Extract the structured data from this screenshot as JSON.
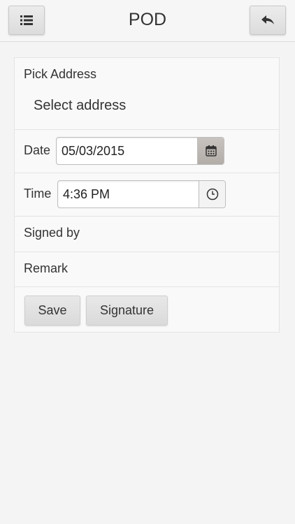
{
  "header": {
    "title": "POD",
    "menu_icon": "list-icon",
    "back_icon": "reply-arrow-icon"
  },
  "form": {
    "pick_address_label": "Pick Address",
    "pick_address_value": "Select address",
    "date_label": "Date",
    "date_value": "05/03/2015",
    "date_icon": "calendar-icon",
    "time_label": "Time",
    "time_value": "4:36 PM",
    "time_icon": "clock-icon",
    "signed_by_label": "Signed by",
    "remark_label": "Remark"
  },
  "actions": {
    "save_label": "Save",
    "signature_label": "Signature"
  }
}
